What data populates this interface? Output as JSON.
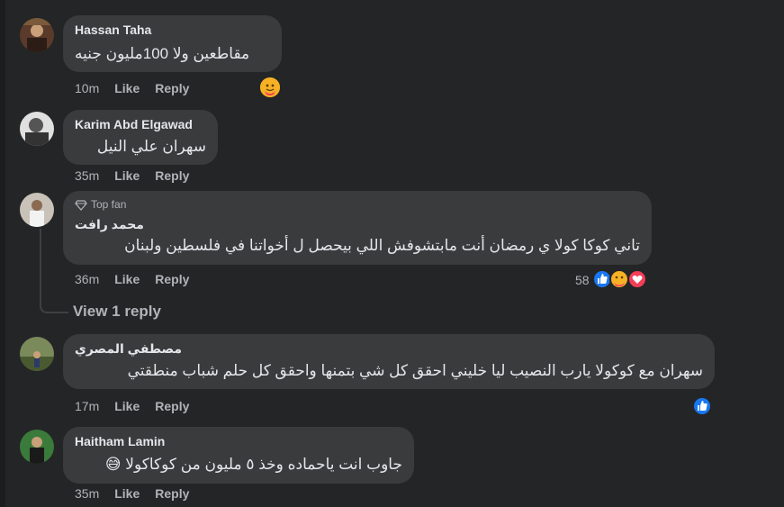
{
  "comments": [
    {
      "author": "Hassan Taha",
      "text": "مقاطعين ولا 100مليون جنيه",
      "time": "10m",
      "like": "Like",
      "reply": "Reply",
      "reaction_icons": [
        "care-emoji-icon"
      ]
    },
    {
      "author": "Karim Abd Elgawad",
      "text": "سهران علي النيل",
      "time": "35m",
      "like": "Like",
      "reply": "Reply"
    },
    {
      "badge": "Top fan",
      "author": "محمد رافت",
      "text": "تاني كوكا كولا ي رمضان أنت مابتشوفش اللي بيحصل ل أخواتنا في فلسطين ولبنان",
      "time": "36m",
      "like": "Like",
      "reply": "Reply",
      "reaction_count": "58",
      "reaction_icons": [
        "like-reaction-icon",
        "care-reaction-icon",
        "love-reaction-icon"
      ],
      "view_replies": "View 1 reply"
    },
    {
      "author": "مصطفي المصري",
      "text": "سهران مع كوكولا يارب النصيب ليا خليني احقق كل شي بتمنها واحقق كل حلم شباب منطقتي",
      "time": "17m",
      "like": "Like",
      "reply": "Reply",
      "reaction_icons": [
        "like-reaction-icon"
      ]
    },
    {
      "author": "Haitham Lamin",
      "text": "جاوب انت ياحماده وخذ ٥ مليون من كوكاكولا 😅",
      "time": "35m",
      "like": "Like",
      "reply": "Reply"
    }
  ],
  "colors": {
    "background": "#242526",
    "bubble": "#3a3b3c",
    "primary_text": "#e4e6eb",
    "secondary_text": "#b0b3b8",
    "like_blue": "#1877f2",
    "love_red": "#f33e58",
    "care_yellow": "#f7b125"
  }
}
